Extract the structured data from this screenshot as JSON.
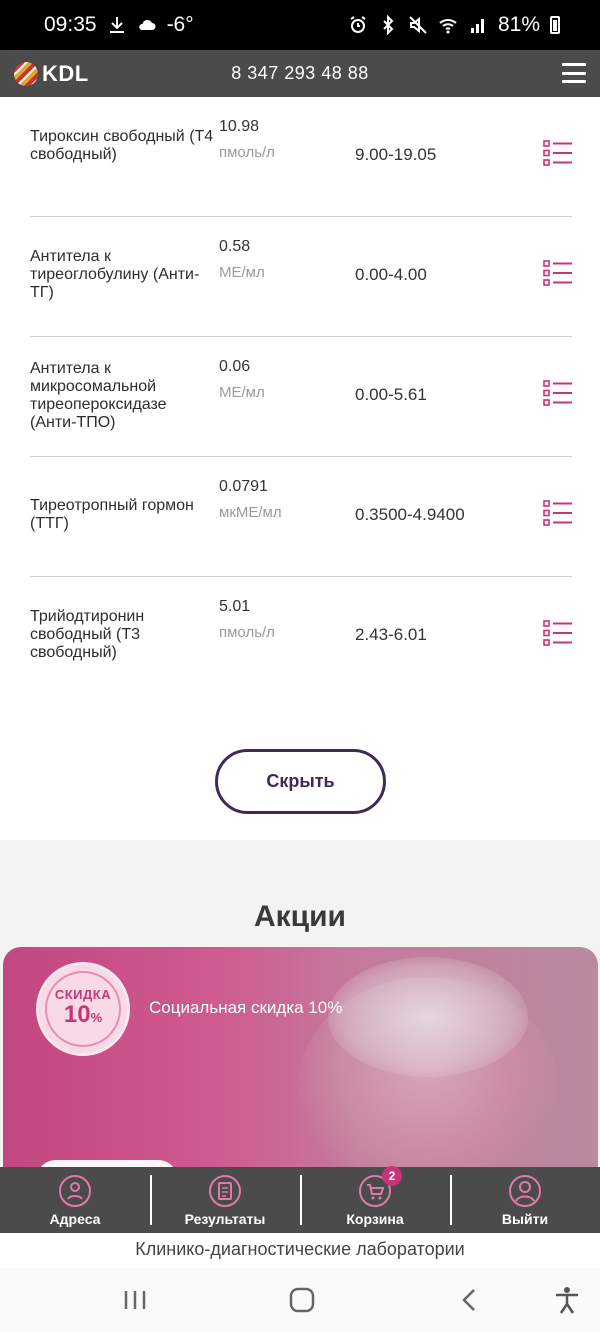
{
  "status_bar": {
    "time": "09:35",
    "temperature": "-6°",
    "battery": "81%"
  },
  "header": {
    "logo": "KDL",
    "phone": "8 347 293 48 88"
  },
  "results": [
    {
      "name": "Тироксин свободный (Т4 свободный)",
      "value": "10.98",
      "unit": "пмоль/л",
      "range": "9.00-19.05"
    },
    {
      "name": "Антитела к тиреоглобулину (Анти-ТГ)",
      "value": "0.58",
      "unit": "МЕ/мл",
      "range": "0.00-4.00"
    },
    {
      "name": "Антитела к микросомальной тиреопероксидазе (Анти-ТПО)",
      "value": "0.06",
      "unit": "МЕ/мл",
      "range": "0.00-5.61"
    },
    {
      "name": "Тиреотропный гормон (ТТГ)",
      "value": "0.0791",
      "unit": "мкМЕ/мл",
      "range": "0.3500-4.9400"
    },
    {
      "name": "Трийодтиронин свободный (Т3 свободный)",
      "value": "5.01",
      "unit": "пмоль/л",
      "range": "2.43-6.01"
    }
  ],
  "hide_button": "Скрыть",
  "promo": {
    "section_title": "Акции",
    "badge_top": "СКИДКА",
    "badge_value": "10",
    "badge_unit": "%",
    "text": "Социальная скидка 10%"
  },
  "bottom_nav": {
    "addresses": "Адреса",
    "results": "Результаты",
    "cart": "Корзина",
    "cart_count": "2",
    "logout": "Выйти"
  },
  "footer_caption": "Клинико-диагностические лаборатории",
  "colors": {
    "accent": "#c8347a",
    "header_bg": "#4b4b4b",
    "button_border": "#3d2a55"
  }
}
